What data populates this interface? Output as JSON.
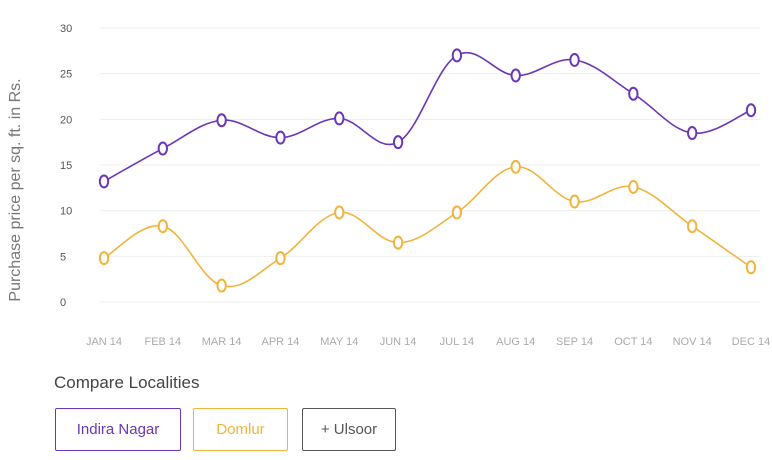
{
  "chart_data": {
    "type": "line",
    "categories": [
      "JAN 14",
      "FEB 14",
      "MAR 14",
      "APR 14",
      "MAY 14",
      "JUN 14",
      "JUL 14",
      "AUG 14",
      "SEP 14",
      "OCT 14",
      "NOV 14",
      "DEC 14"
    ],
    "series": [
      {
        "name": "Indira Nagar",
        "color": "#6a35b8",
        "values": [
          13.2,
          16.8,
          19.9,
          18.0,
          20.1,
          17.5,
          27.0,
          24.8,
          26.5,
          22.8,
          18.5,
          21.0
        ]
      },
      {
        "name": "Domlur",
        "color": "#f0b43c",
        "values": [
          4.8,
          8.3,
          1.8,
          4.8,
          9.8,
          6.5,
          9.8,
          14.8,
          11.0,
          12.6,
          8.3,
          3.8
        ]
      }
    ],
    "ylabel": "Purchase price per sq. ft. in Rs.",
    "xlabel": "",
    "ylim": [
      0,
      30
    ],
    "yticks": [
      0,
      5,
      10,
      15,
      20,
      25,
      30
    ],
    "grid": true,
    "curve": "smooth"
  },
  "compare": {
    "title": "Compare Localities",
    "buttons": [
      {
        "label": "Indira Nagar",
        "color": "#6a35b8"
      },
      {
        "label": "Domlur",
        "color": "#f0b43c"
      },
      {
        "label": "+ Ulsoor",
        "color": "#555555"
      }
    ]
  }
}
